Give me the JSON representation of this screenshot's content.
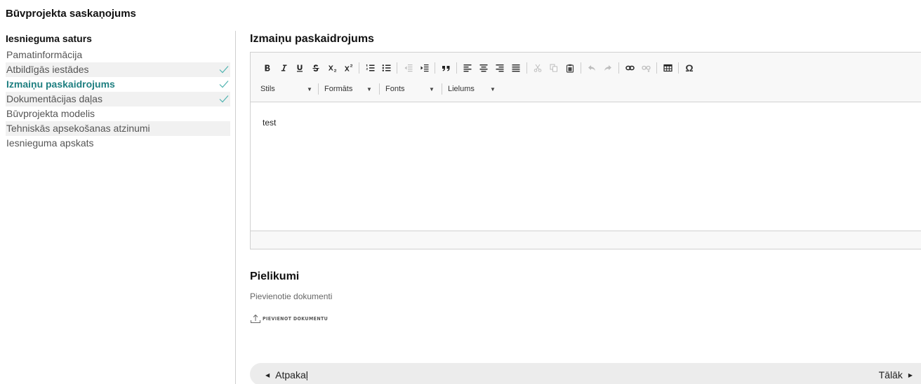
{
  "header": {
    "title": "Būvprojekta saskaņojums"
  },
  "sidebar": {
    "heading": "Iesnieguma saturs",
    "items": [
      {
        "label": "Pamatinformācija",
        "completed": false,
        "active": false
      },
      {
        "label": "Atbildīgās iestādes",
        "completed": true,
        "active": false
      },
      {
        "label": "Izmaiņu paskaidrojums",
        "completed": true,
        "active": true
      },
      {
        "label": "Dokumentācijas daļas",
        "completed": true,
        "active": false
      },
      {
        "label": "Būvprojekta modelis",
        "completed": false,
        "active": false
      },
      {
        "label": "Tehniskās apsekošanas atzinumi",
        "completed": false,
        "active": false
      },
      {
        "label": "Iesnieguma apskats",
        "completed": false,
        "active": false
      }
    ]
  },
  "editor": {
    "title": "Izmaiņu paskaidrojums",
    "toolbar": {
      "combos": [
        "Stils",
        "Formāts",
        "Fonts",
        "Lielums"
      ]
    },
    "content": "test"
  },
  "attachments": {
    "title": "Pielikumi",
    "subtitle": "Pievienotie dokumenti",
    "add_label": "PIEVIENOT DOKUMENTU"
  },
  "navigation": {
    "back_label": "Atpakaļ",
    "next_label": "Tālāk"
  },
  "colors": {
    "accent": "#1e7f80",
    "check": "#4fb3b0",
    "shade": "#f1f1f1"
  }
}
